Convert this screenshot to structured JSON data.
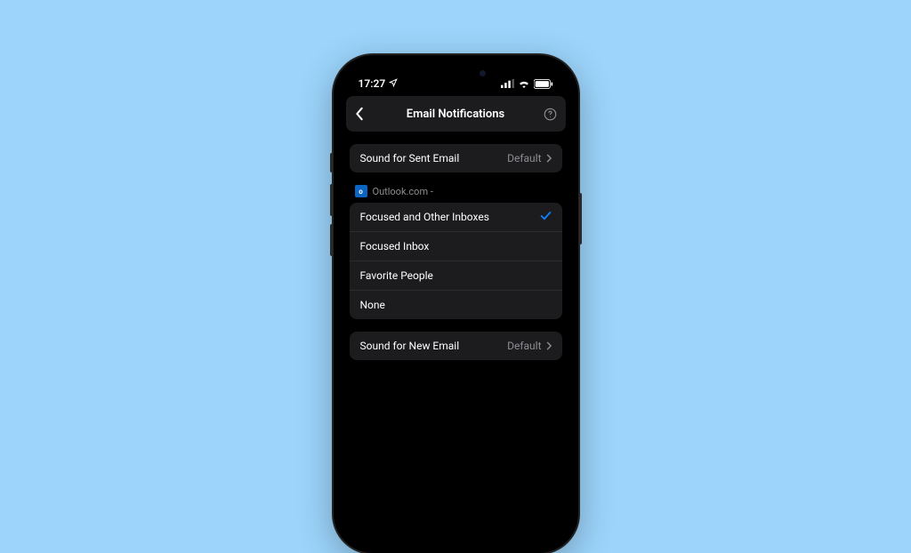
{
  "status": {
    "time": "17:27"
  },
  "nav": {
    "title": "Email Notifications"
  },
  "soundSent": {
    "label": "Sound for Sent Email",
    "value": "Default"
  },
  "account": {
    "provider": "Outlook.com -"
  },
  "options": {
    "0": {
      "label": "Focused and Other Inboxes"
    },
    "1": {
      "label": "Focused Inbox"
    },
    "2": {
      "label": "Favorite People"
    },
    "3": {
      "label": "None"
    }
  },
  "soundNew": {
    "label": "Sound for New Email",
    "value": "Default"
  }
}
